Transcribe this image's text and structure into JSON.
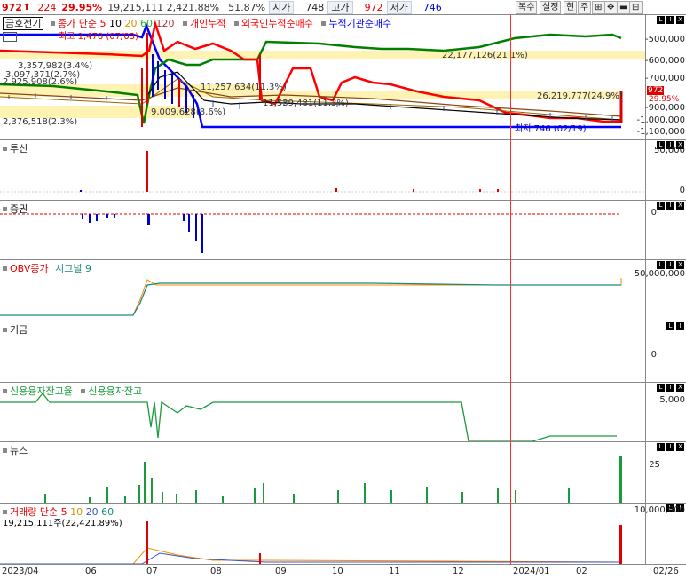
{
  "topbar": {
    "price": "972",
    "change": "224",
    "change_pct": "29.95%",
    "volume": "19,215,111",
    "volume_ratio": "2,421.88%",
    "turnover": "51.87%",
    "open_label": "시가",
    "open_value": "748",
    "high_label": "고가",
    "high_value": "972",
    "low_label": "저가",
    "low_value": "746",
    "buttons": [
      "복수",
      "설정",
      "현",
      "주"
    ]
  },
  "main_panel": {
    "stock_name": "금호전기",
    "ma_legend": "종가 단순 5",
    "ma_periods": [
      "10",
      "20",
      "60",
      "120"
    ],
    "series_legend": [
      "개인누적",
      "외국인누적순매수",
      "누적기관순매수"
    ],
    "y_labels": [
      "-500,000",
      "-600,000",
      "-700,000",
      "-800,000",
      "-900,000",
      "-1,000,000",
      "-1,100,000"
    ],
    "price_tag": "972",
    "price_tag_pct": "29.95%",
    "annotations": {
      "high": "최고 1,478 (07/03)",
      "low": "최저 746 (02/19)",
      "a1": "3,357,982(3.4%)",
      "a2": "3,097,371(2.7%)",
      "a3": "2,925,908(2.6%)",
      "a4": "2,376,518(2.3%)",
      "a5": "22,177,126(21.1%)",
      "a6": "26,219,777(24.9%)",
      "a7": "11,257,634(11.3%)",
      "a8": "11,539,481(11.3%)",
      "a9": "9,009,628(8.6%)"
    }
  },
  "panels": {
    "trust": {
      "title": "투신",
      "y_labels": [
        "50,000",
        "0"
      ]
    },
    "securities": {
      "title": "증권",
      "y_labels": [
        "0"
      ]
    },
    "obv": {
      "title": "OBV종가",
      "signal": "시그널 9",
      "y_labels": [
        "50,000,000"
      ]
    },
    "other": {
      "title": "기금",
      "y_labels": [
        "0"
      ]
    },
    "credit": {
      "title": "신용융자잔고율",
      "title2": "신용융자잔고",
      "y_labels": [
        "5,000"
      ]
    },
    "news": {
      "title": "뉴스",
      "y_labels": [
        "25"
      ]
    },
    "volume": {
      "title": "거래량 단순",
      "periods": [
        "5",
        "10",
        "20",
        "60"
      ],
      "info": "19,215,111주(22,421.89%)",
      "y_labels": [
        "10,000,000"
      ]
    }
  },
  "x_axis": [
    "2023/04",
    "06",
    "07",
    "08",
    "09",
    "10",
    "11",
    "12",
    "2024/01",
    "02",
    "02/26"
  ],
  "colors": {
    "up": "#e00000",
    "down": "#0000cc",
    "individual": "#ff0000",
    "foreign": "#008000",
    "institution": "#0000ff",
    "highlight": "#fff0a0",
    "obv": "#1a8a7a",
    "credit": "#1a9a3a"
  }
}
